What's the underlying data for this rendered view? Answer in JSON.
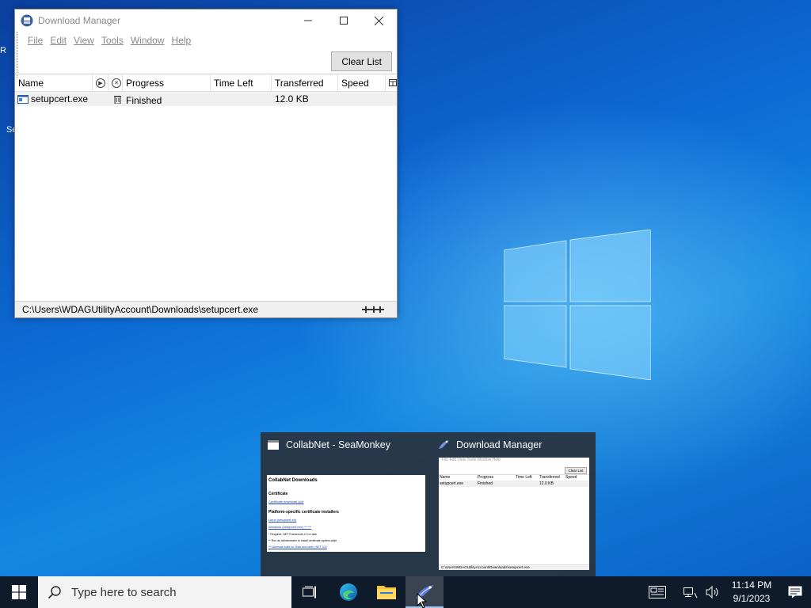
{
  "desktop": {
    "icon_fragments": [
      "R",
      "Se"
    ]
  },
  "download_manager": {
    "title": "Download Manager",
    "menu": [
      "File",
      "Edit",
      "View",
      "Tools",
      "Window",
      "Help"
    ],
    "clear_list_label": "Clear List",
    "columns": {
      "name": "Name",
      "progress": "Progress",
      "time_left": "Time Left",
      "transferred": "Transferred",
      "speed": "Speed"
    },
    "downloads": [
      {
        "name": "setupcert.exe",
        "progress": "Finished",
        "time_left": "",
        "transferred": "12.0 KB",
        "speed": ""
      }
    ],
    "status_path": "C:\\Users\\WDAGUtilityAccount\\Downloads\\setupcert.exe"
  },
  "taskbar_preview": {
    "items": [
      {
        "title": "CollabNet - SeaMonkey",
        "page": {
          "heading": "CollabNet Downloads",
          "certificate_heading": "Certificate",
          "certificate_link": "Certificate download (crt)",
          "installers_heading": "Platform-specific certificate installers",
          "link1": "Linux (setupcert.sh)",
          "link2": "Windows (setupcert.exe) ** ***",
          "note1": "* Requires .NET Framework 4.0 or later",
          "note2": "** Run as administrator to install certificate system-wide",
          "note3": "*** Alternate build for Vista and older (.NET 3.5)"
        }
      },
      {
        "title": "Download Manager",
        "mini": {
          "clear_list_label": "Clear List",
          "menu": "File Edit View Tools Window Help",
          "col_name": "Name",
          "col_progress": "Progress",
          "col_time_left": "Time Left",
          "col_transferred": "Transferred",
          "col_speed": "Speed",
          "row_name": "setupcert.exe",
          "row_progress": "Finished",
          "row_transferred": "12.0 KB",
          "status": "C:\\Users\\WDAGUtilityAccount\\Downloads\\setupcert.exe"
        }
      }
    ]
  },
  "taskbar": {
    "search_placeholder": "Type here to search",
    "apps": [
      "task-view",
      "edge",
      "file-explorer",
      "seamonkey"
    ],
    "active_app": "seamonkey",
    "clock_time": "11:14 PM",
    "clock_date": "9/1/2023"
  },
  "colors": {
    "desktop_blue": "#0a63c7",
    "taskbar": "#0f1a2a",
    "preview_bg": "#28323c",
    "row_selected": "#f0f0f0"
  }
}
